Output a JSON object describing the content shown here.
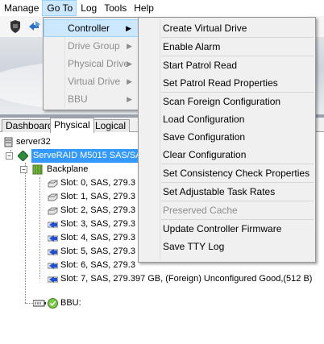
{
  "menubar": {
    "items": [
      "Manage",
      "Go To",
      "Log",
      "Tools",
      "Help"
    ],
    "active_index": 1
  },
  "tabs": [
    "Dashboard",
    "Physical",
    "Logical"
  ],
  "selected_tab": "Physical",
  "tree": {
    "server": "server32",
    "controller": "ServeRAID M5015 SAS/SAT",
    "backplane": "Backplane",
    "slots": [
      "Slot: 0, SAS, 279.3",
      "Slot: 1, SAS, 279.3",
      "Slot: 2, SAS, 279.3",
      "Slot: 3, SAS, 279.3",
      "Slot: 4, SAS, 279.3",
      "Slot: 5, SAS, 279.3",
      "Slot: 6, SAS, 279.3",
      "Slot: 7, SAS, 279.397 GB, (Foreign) Unconfigured Good,(512 B)"
    ],
    "bbu": "BBU:"
  },
  "goto_menu": {
    "items": [
      {
        "label": "Controller",
        "disabled": false,
        "submenu": true
      },
      {
        "label": "Drive Group",
        "disabled": true,
        "submenu": true
      },
      {
        "label": "Physical Drive",
        "disabled": true,
        "submenu": true
      },
      {
        "label": "Virtual Drive",
        "disabled": true,
        "submenu": true
      },
      {
        "label": "BBU",
        "disabled": true,
        "submenu": true
      }
    ]
  },
  "controller_menu": {
    "items": [
      "Create Virtual Drive",
      "Enable Alarm",
      "Start Patrol Read",
      "Set Patrol Read Properties",
      "Scan Foreign Configuration",
      "Load Configuration",
      "Save Configuration",
      "Clear Configuration",
      "Set Consistency Check Properties",
      "Set Adjustable Task Rates",
      "Preserved Cache",
      "Update Controller Firmware",
      "Save TTY Log"
    ],
    "disabled_items": [
      "Preserved Cache"
    ]
  },
  "colors": {
    "selection": "#3399ff",
    "menu_hover": "#cce8ff",
    "controller_icon": "#2e8b3a",
    "disk_arrow": "#1e4fd8"
  },
  "icons": {
    "toolbar": [
      "shield-icon",
      "refresh-icon"
    ],
    "server": "server-icon",
    "controller": "controller-icon",
    "backplane": "backplane-icon",
    "slot": "disk-icon",
    "bbu": "battery-icon"
  }
}
